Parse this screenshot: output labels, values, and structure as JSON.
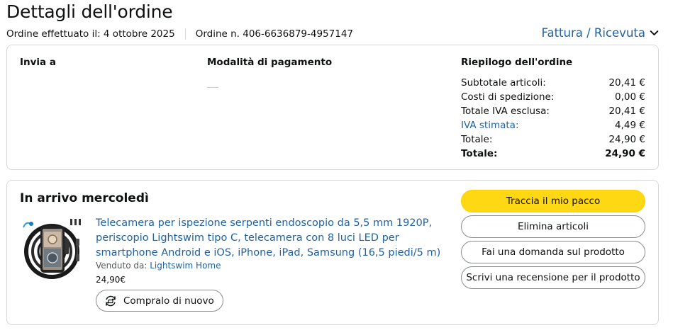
{
  "header": {
    "title": "Dettagli dell'ordine",
    "order_date": "Ordine effettuato il: 4 ottobre 2025",
    "order_number": "Ordine n. 406-6636879-4957147",
    "invoice_link": "Fattura / Ricevuta"
  },
  "summary_card": {
    "ship_to_heading": "Invia a",
    "payment_heading": "Modalità di pagamento",
    "order_summary_heading": "Riepilogo dell'ordine",
    "rows": [
      {
        "label": "Subtotale articoli:",
        "value": "20,41 €"
      },
      {
        "label": "Costi di spedizione:",
        "value": "0,00 €"
      },
      {
        "label": "Totale IVA esclusa:",
        "value": "20,41 €"
      },
      {
        "label": "IVA stimata:",
        "value": "4,49 €"
      },
      {
        "label": "Totale:",
        "value": "24,90 €"
      },
      {
        "label": "Totale:",
        "value": "24,90 €"
      }
    ]
  },
  "shipment": {
    "arrival": "In arrivo mercoledì",
    "product_title": "Telecamera per ispezione serpenti endoscopio da 5,5 mm 1920P, periscopio Lightswim tipo C, telecamera con 8 luci LED per smartphone Android e iOS, iPhone, iPad, Samsung (16,5 piedi/5 m)",
    "sold_by_label": "Venduto da:",
    "seller": "Lightswim Home",
    "price": "24,90€",
    "buy_again": "Compralo di nuovo",
    "actions": {
      "track": "Traccia il mio pacco",
      "delete": "Elimina articoli",
      "question": "Fai una domanda sul prodotto",
      "review": "Scrivi una recensione per il prodotto"
    }
  },
  "colors": {
    "link": "#2162a1",
    "primary_button": "#ffd814",
    "border": "#d5d9d9",
    "text": "#0f1111"
  }
}
